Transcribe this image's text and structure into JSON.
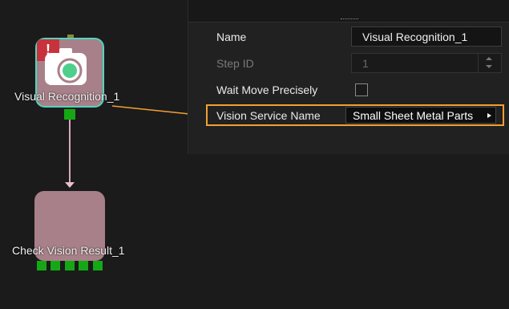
{
  "properties": {
    "name_label": "Name",
    "name_value": "Visual Recognition_1",
    "step_id_label": "Step ID",
    "step_id_value": "1",
    "wait_move_label": "Wait Move Precisely",
    "wait_move_checked": false,
    "vision_service_label": "Vision Service Name",
    "vision_service_value": "Small Sheet Metal Parts"
  },
  "flow": {
    "node1": {
      "label": "Visual Recognition_1",
      "status": "error",
      "icon": "camera-icon",
      "error_symbol": "!"
    },
    "node2": {
      "label": "Check Vision Result_1",
      "icon": "camera-check-icon"
    }
  },
  "colors": {
    "highlight": "#f0a030",
    "node_fill": "#a88089",
    "node_selected_border": "#4fd6bd",
    "port": "#14a814",
    "error": "#c8323c"
  }
}
